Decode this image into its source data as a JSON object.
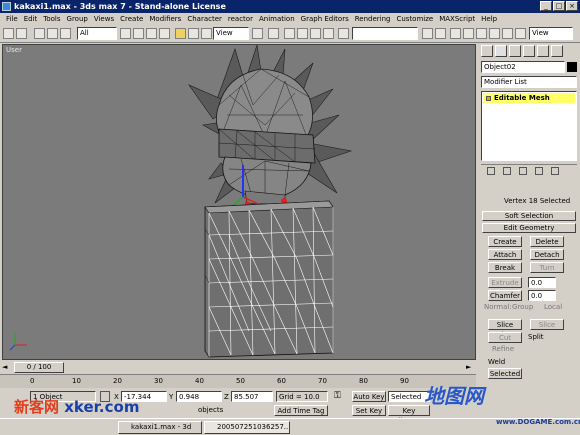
{
  "window": {
    "title": "kakaxi1.max - 3ds max 7 - Stand-alone License",
    "min": "_",
    "max": "□",
    "close": "×"
  },
  "menu": [
    "File",
    "Edit",
    "Tools",
    "Group",
    "Views",
    "Create",
    "Modifiers",
    "Character",
    "reactor",
    "Animation",
    "Graph Editors",
    "Rendering",
    "Customize",
    "MAXScript",
    "Help"
  ],
  "toolbar": {
    "filter": "All",
    "refcoord": "View",
    "named_sel": "",
    "render_sel": "View"
  },
  "viewport": {
    "label": "User"
  },
  "command_panel": {
    "object_name": "Object02",
    "modifier_list": "Modifier List",
    "stack_item": "Editable Mesh",
    "status": "Vertex 18 Selected",
    "rollouts": {
      "soft_selection": "Soft Selection",
      "edit_geometry": "Edit Geometry"
    },
    "buttons": {
      "create": "Create",
      "delete": "Delete",
      "attach": "Attach",
      "detach": "Detach",
      "break": "Break",
      "turn": "Turn",
      "extrude": "Extrude",
      "chamfer": "Chamfer",
      "slice_plane": "Slice Plan",
      "slice": "Slice",
      "cut": "Cut",
      "split": "Split",
      "refine": "Refine",
      "weld": "Weld",
      "selected": "Selected"
    },
    "values": {
      "extrude": "0.0",
      "chamfer": "0.0"
    },
    "normal": {
      "label": "Normal:",
      "group": "Group",
      "local": "Local"
    }
  },
  "timeline": {
    "frame": "0 / 100",
    "ticks": [
      "0",
      "10",
      "20",
      "30",
      "40",
      "50",
      "60",
      "70",
      "80",
      "90"
    ]
  },
  "status": {
    "object": "1 Object",
    "x_label": "X",
    "x": "-17.344",
    "y_label": "Y",
    "y": "0.948",
    "z_label": "Z",
    "z": "85.507",
    "grid": "Grid = 10.0",
    "objects_label": "objects",
    "add_time_tag": "Add Time Tag",
    "auto_key": "Auto Key",
    "set_key": "Set Key",
    "key_filters": "Key Filters...",
    "key_mode": "Selected"
  },
  "taskbar": {
    "items": [
      "kakaxi1.max - 3d",
      "200507251036257..."
    ]
  },
  "watermarks": {
    "left_cn": "新客网",
    "left_en": "xker.com",
    "right_logo": "地图网",
    "right_url": "www.DOGAME.com.cn"
  },
  "colors": {
    "titlebar": "#0a246a",
    "viewport": "#7b7b7b",
    "stack_highlight": "#ffff66",
    "wire_white": "#ffffff"
  }
}
